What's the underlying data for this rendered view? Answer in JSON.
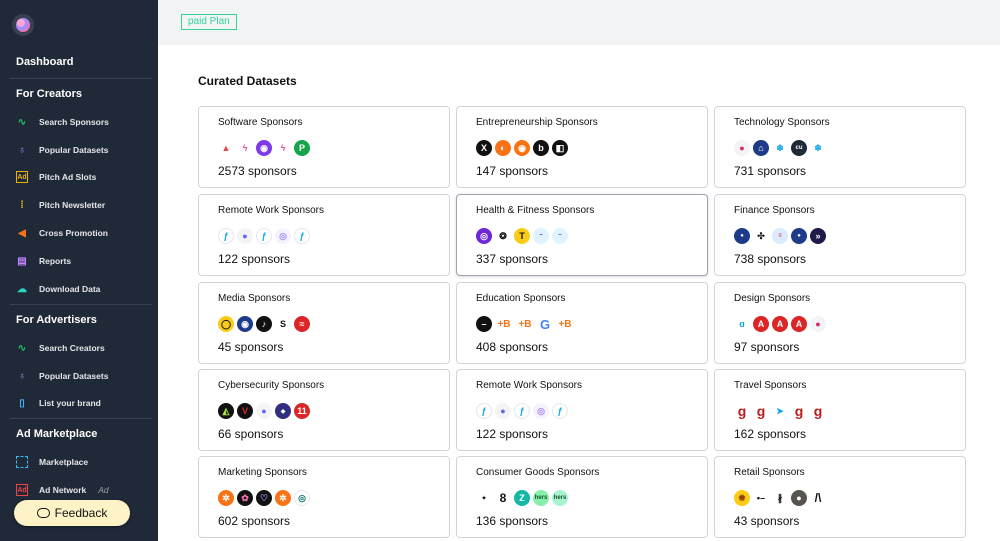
{
  "sidebar": {
    "dashboard": "Dashboard",
    "sections": [
      {
        "title": "For Creators",
        "items": [
          {
            "label": "Search Sponsors",
            "icon": "pulse-icon"
          },
          {
            "label": "Popular Datasets",
            "icon": "flame-icon"
          },
          {
            "label": "Pitch Ad Slots",
            "icon": "ad-icon"
          },
          {
            "label": "Pitch Newsletter",
            "icon": "dots-icon"
          },
          {
            "label": "Cross Promotion",
            "icon": "megaphone-icon"
          },
          {
            "label": "Reports",
            "icon": "report-icon"
          },
          {
            "label": "Download Data",
            "icon": "cloud-download-icon"
          }
        ]
      },
      {
        "title": "For Advertisers",
        "items": [
          {
            "label": "Search Creators",
            "icon": "pulse-icon"
          },
          {
            "label": "Popular Datasets",
            "icon": "flame-icon"
          },
          {
            "label": "List your brand",
            "icon": "document-icon"
          }
        ]
      },
      {
        "title": "Ad Marketplace",
        "items": [
          {
            "label": "Marketplace",
            "icon": "grid-icon"
          },
          {
            "label": "Ad Network",
            "icon": "ad-icon",
            "tag": "Ad"
          }
        ]
      }
    ],
    "feedback": "Feedback"
  },
  "topbar": {
    "plan": "paid Plan"
  },
  "main": {
    "title": "Curated Datasets",
    "cards": [
      {
        "name": "Software Sponsors",
        "count": "2573 sponsors"
      },
      {
        "name": "Entrepreneurship Sponsors",
        "count": "147 sponsors"
      },
      {
        "name": "Technology Sponsors",
        "count": "731 sponsors"
      },
      {
        "name": "Remote Work Sponsors",
        "count": "122 sponsors"
      },
      {
        "name": "Health & Fitness Sponsors",
        "count": "337 sponsors"
      },
      {
        "name": "Finance Sponsors",
        "count": "738 sponsors"
      },
      {
        "name": "Media Sponsors",
        "count": "45 sponsors"
      },
      {
        "name": "Education Sponsors",
        "count": "408 sponsors"
      },
      {
        "name": "Design Sponsors",
        "count": "97 sponsors"
      },
      {
        "name": "Cybersecurity Sponsors",
        "count": "66 sponsors"
      },
      {
        "name": "Remote Work Sponsors",
        "count": "122 sponsors"
      },
      {
        "name": "Travel Sponsors",
        "count": "162 sponsors"
      },
      {
        "name": "Marketing Sponsors",
        "count": "602 sponsors"
      },
      {
        "name": "Consumer Goods Sponsors",
        "count": "136 sponsors"
      },
      {
        "name": "Retail Sponsors",
        "count": "43 sponsors"
      }
    ]
  }
}
